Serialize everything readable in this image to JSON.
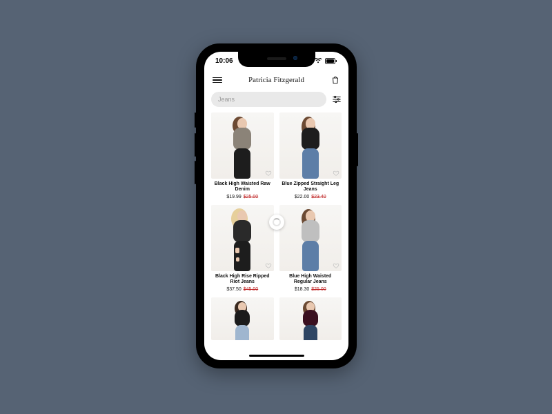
{
  "status": {
    "time": "10:06"
  },
  "header": {
    "brand": "Patricia Fitzgerald"
  },
  "search": {
    "value": "Jeans"
  },
  "products": [
    {
      "title": "Black High Waisted Raw Denim",
      "price": "$19.99",
      "old": "$25.00"
    },
    {
      "title": "Blue Zipped Straight Leg Jeans",
      "price": "$22.00",
      "old": "$23.40"
    },
    {
      "title": "Black High Rise Ripped Riot Jeans",
      "price": "$37.50",
      "old": "$45.00"
    },
    {
      "title": "Blue High Waisted Regular Jeans",
      "price": "$18.30",
      "old": "$25.00"
    }
  ]
}
